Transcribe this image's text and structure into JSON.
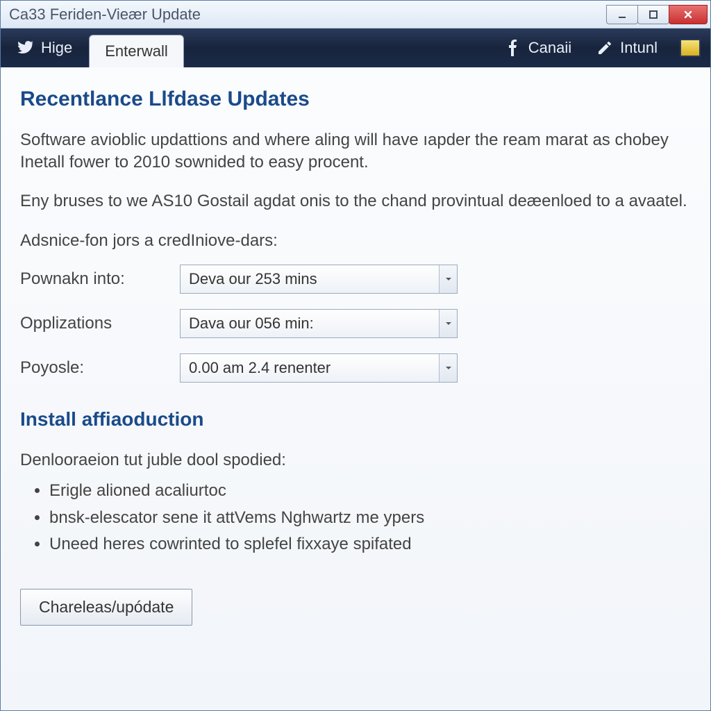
{
  "window": {
    "title": "Ca33 Feriden-Vieær Update"
  },
  "navbar": {
    "left_item": "Hige",
    "active_tab": "Enterwall",
    "right1": "Canaii",
    "right2": "Intunl"
  },
  "content": {
    "heading1": "Recentlance Llfdase Updates",
    "para1": "Software avioblic updattions and where aling will have ıapder the ream marat as chobey Inetall fower to 2010 sownided to easy procent.",
    "para2": "Eny bruses to we AS10 Gostail agdat onis to the chand provintual deæenloed to a avaatel.",
    "form_intro": "Adsnice-fon jors a credIniove-dars:",
    "rows": [
      {
        "label": "Pownakn into:",
        "value": "Deva our 253 mins"
      },
      {
        "label": "Opplizations",
        "value": "Dava our 056 min:"
      },
      {
        "label": "Poyosle:",
        "value": "0.00 am 2.4 renenter"
      }
    ],
    "heading2": "Install affiaoduction",
    "list_intro": "Denlooraeion tut juble dool spodied:",
    "bullets": [
      "Erigle alioned acaliurtoc",
      "bnsk-elescator sene it attVems Nghwartz me ypers",
      "Uneed heres cowrinted to splefel fixxaye spifated"
    ],
    "button": "Chareleas/upódate"
  }
}
